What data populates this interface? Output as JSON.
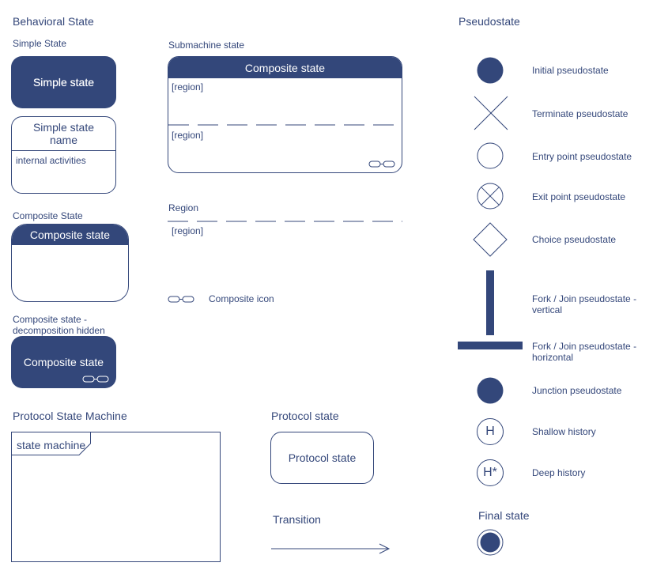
{
  "behavioral": {
    "title": "Behavioral State",
    "simple_label": "Simple State",
    "simple_state": "Simple state",
    "simple_state_name": "Simple state name",
    "internal_activities": "internal activities",
    "composite_label": "Composite State",
    "composite_state": "Composite state",
    "hidden_label_line1": "Composite state -",
    "hidden_label_line2": "decomposition hidden",
    "hidden_state": "Composite state"
  },
  "submachine": {
    "label": "Submachine state",
    "header": "Composite state",
    "region1": "[region]",
    "region2": "[region]"
  },
  "region_section": {
    "label": "Region",
    "region": "[region]"
  },
  "composite_icon": {
    "label": "Composite icon"
  },
  "protocol_machine": {
    "title": "Protocol State Machine",
    "tab": "state machine"
  },
  "protocol_state": {
    "title": "Protocol state",
    "state": "Protocol state"
  },
  "transition": {
    "title": "Transition"
  },
  "pseudostate": {
    "title": "Pseudostate",
    "items": [
      {
        "icon": "initial-filled-circle",
        "label": "Initial pseudostate"
      },
      {
        "icon": "terminate-x",
        "label": "Terminate pseudostate"
      },
      {
        "icon": "entry-open-circle",
        "label": "Entry point pseudostate"
      },
      {
        "icon": "exit-crossed-circle",
        "label": "Exit point pseudostate"
      },
      {
        "icon": "choice-diamond",
        "label": "Choice pseudostate"
      },
      {
        "icon": "fork-vertical-bar",
        "label_line1": "Fork / Join pseudostate -",
        "label_line2": "vertical"
      },
      {
        "icon": "fork-horizontal-bar",
        "label_line1": "Fork / Join pseudostate -",
        "label_line2": "horizontal"
      },
      {
        "icon": "junction-filled-circle",
        "label": "Junction pseudostate"
      },
      {
        "icon": "shallow-history",
        "glyph": "H",
        "label": "Shallow history"
      },
      {
        "icon": "deep-history",
        "glyph": "H*",
        "label": "Deep history"
      }
    ]
  },
  "final_state": {
    "title": "Final state"
  },
  "colors": {
    "primary": "#33477a",
    "text": "#34477a",
    "background": "#ffffff"
  }
}
